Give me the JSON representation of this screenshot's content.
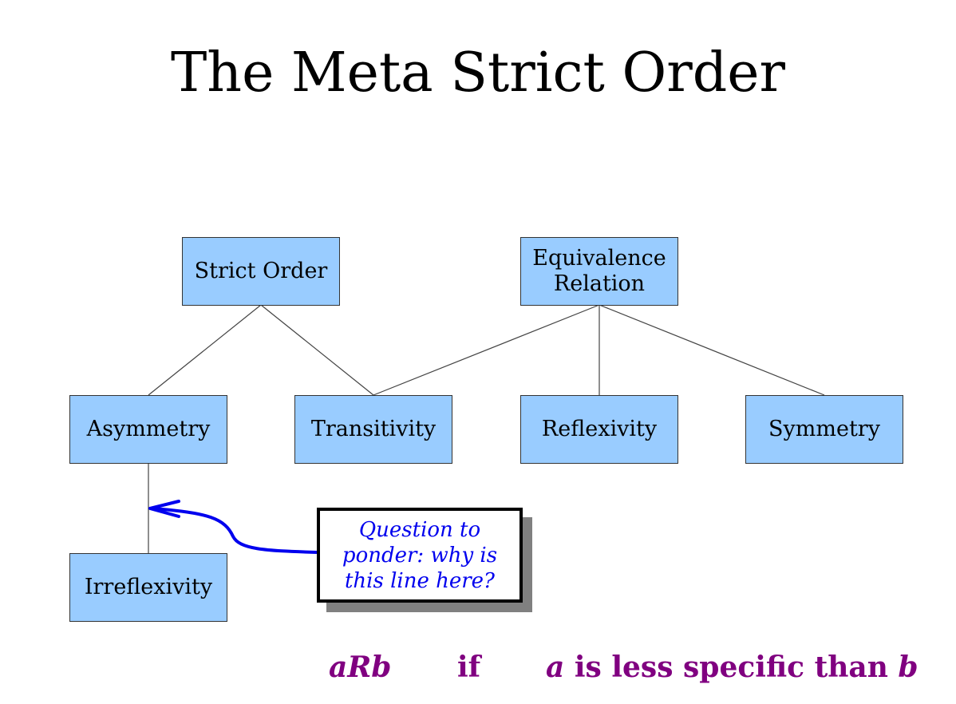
{
  "title": "The Meta Strict Order",
  "nodes": {
    "strict_order": "Strict Order",
    "equivalence_line1": "Equivalence",
    "equivalence_line2": "Relation",
    "asymmetry": "Asymmetry",
    "transitivity": "Transitivity",
    "reflexivity": "Reflexivity",
    "symmetry": "Symmetry",
    "irreflexivity": "Irreflexivity"
  },
  "callout": {
    "line1": "Question to",
    "line2": "ponder: why is",
    "line3": "this line here?"
  },
  "formula": {
    "relation": "aRb",
    "connective": "if",
    "a_var": "a",
    "phrase": "is less specific than",
    "b_var": "b"
  },
  "colors": {
    "node_fill": "#99ccff",
    "arrow": "#0000ee",
    "formula": "#800080"
  }
}
